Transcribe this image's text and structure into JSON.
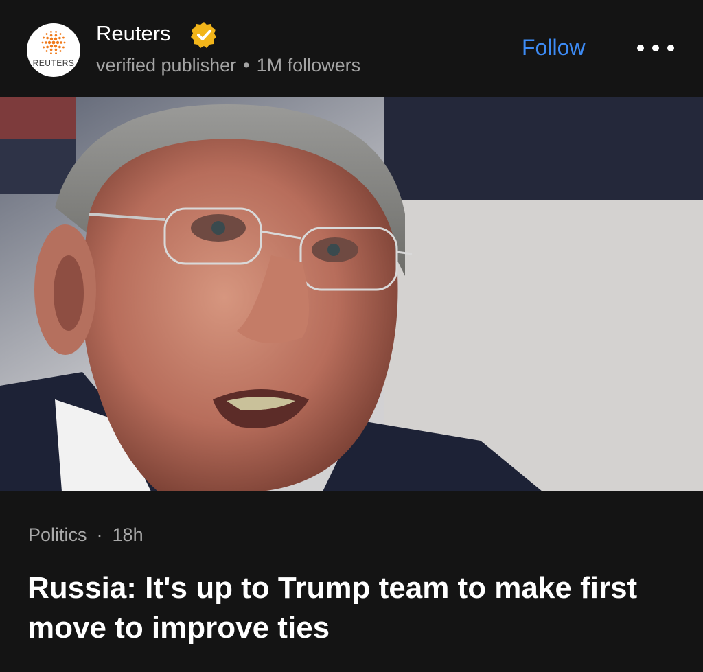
{
  "publisher": {
    "name": "Reuters",
    "logo_text": "REUTERS",
    "verified_label": "verified publisher",
    "separator": "•",
    "followers": "1M followers",
    "follow_label": "Follow",
    "more_icon": "ellipsis-icon",
    "verified_icon": "verified-badge-icon",
    "accent_color": "#3d8bf5",
    "badge_color": "#f2b51a"
  },
  "article": {
    "category": "Politics",
    "separator": "·",
    "age": "18h",
    "headline": "Russia: It's up to Trump team to make first move to improve ties"
  }
}
